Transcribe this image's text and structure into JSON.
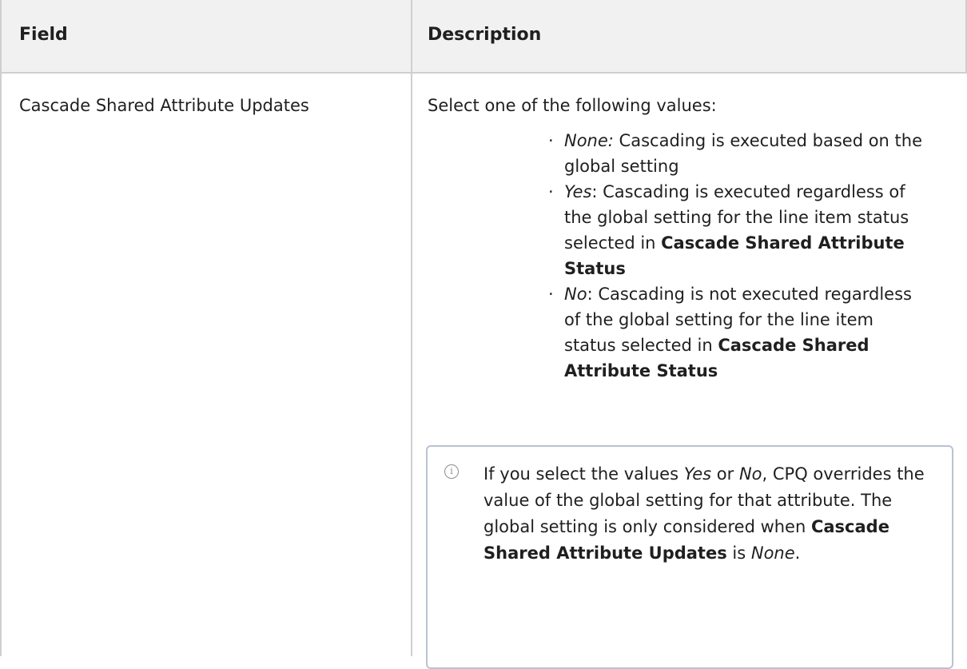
{
  "header": {
    "col1": "Field",
    "col2": "Description"
  },
  "row": {
    "field": "Cascade Shared Attribute Updates",
    "intro": "Select one of the following values:",
    "bullets": [
      {
        "term": "None:",
        "text": " Cascading is executed based on the global setting"
      },
      {
        "term": "Yes",
        "text_before": ": Cascading is executed regardless of the global setting for the line item status selected in ",
        "strong": "Cascade Shared Attribute Status"
      },
      {
        "term": "No",
        "text_before": ": Cascading is not executed regardless of the global setting for the line item status selected in ",
        "strong": "Cascade Shared Attribute Status"
      }
    ],
    "note": {
      "icon": "info-icon",
      "p1": "If you select the values ",
      "yes": "Yes",
      "or": " or ",
      "no": "No",
      "p2": ", CPQ overrides the value of the global setting for that attribute. The global setting is only considered when ",
      "strong": "Cascade Shared Attribute Updates",
      "is": " is ",
      "none": "None",
      "end": "."
    }
  }
}
